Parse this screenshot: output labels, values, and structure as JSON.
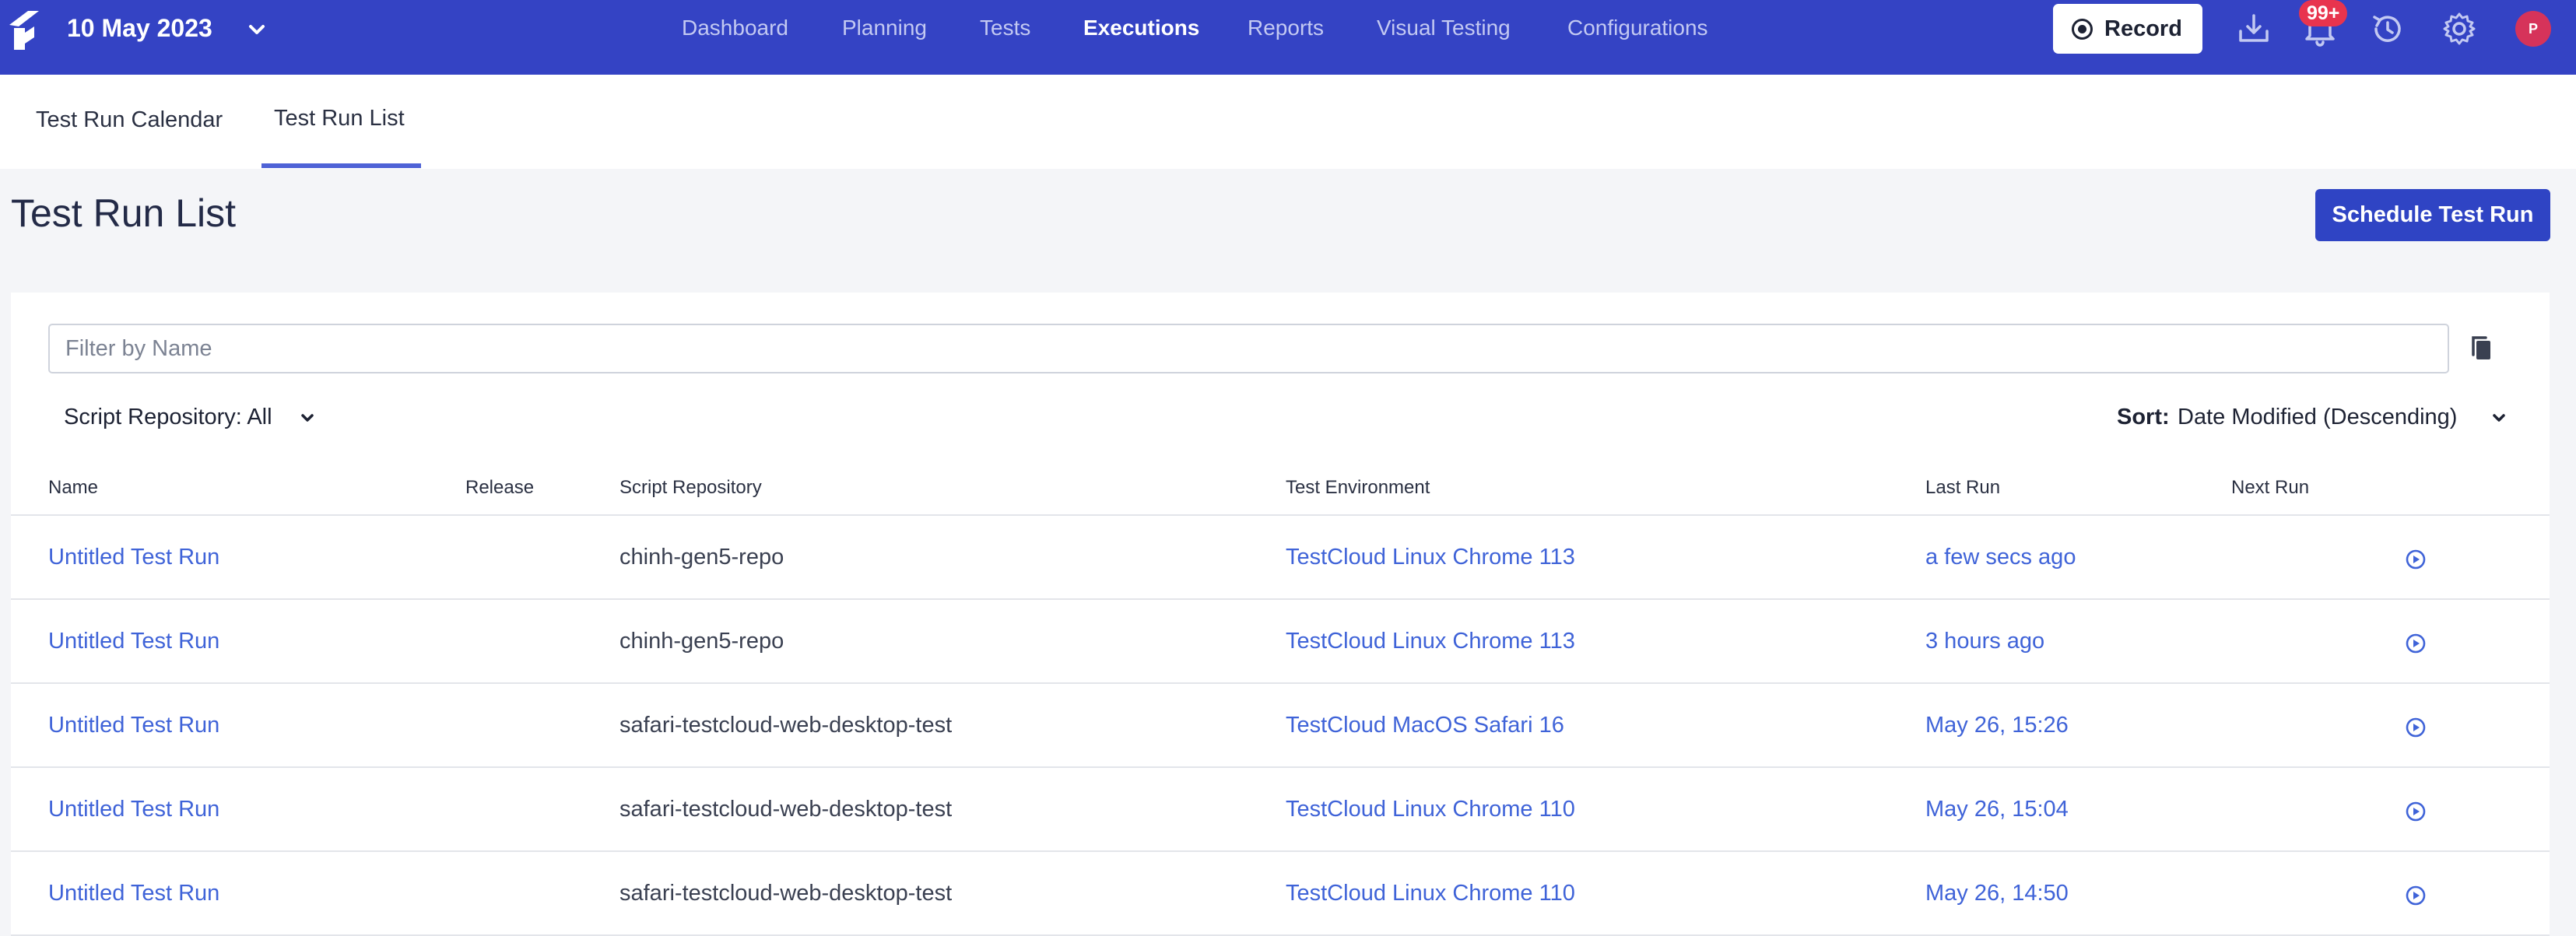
{
  "header": {
    "date": "10 May 2023",
    "nav": [
      "Dashboard",
      "Planning",
      "Tests",
      "Executions",
      "Reports",
      "Visual Testing",
      "Configurations"
    ],
    "active_nav": "Executions",
    "record_label": "Record",
    "notification_count": "99+",
    "avatar_initial": "P",
    "icons": [
      "logo-icon",
      "chevron-down-icon",
      "record-icon",
      "download-icon",
      "bell-icon",
      "history-icon",
      "gear-icon"
    ]
  },
  "tabs": {
    "calendar": "Test Run Calendar",
    "list": "Test Run List",
    "active": "Test Run List"
  },
  "page": {
    "title": "Test Run List",
    "schedule_button": "Schedule Test Run"
  },
  "filters": {
    "name_placeholder": "Filter by Name",
    "name_value": "",
    "repository": "Script Repository: All",
    "sort_label": "Sort:",
    "sort_value": "Date Modified (Descending)"
  },
  "table": {
    "columns": {
      "name": "Name",
      "release": "Release",
      "repository": "Script Repository",
      "environment": "Test Environment",
      "last_run": "Last Run",
      "next_run": "Next Run"
    },
    "rows": [
      {
        "name": "Untitled Test Run",
        "release": "",
        "repository": "chinh-gen5-repo",
        "environment": "TestCloud Linux Chrome 113",
        "last_run": "a few secs ago",
        "next_run": ""
      },
      {
        "name": "Untitled Test Run",
        "release": "",
        "repository": "chinh-gen5-repo",
        "environment": "TestCloud Linux Chrome 113",
        "last_run": "3 hours ago",
        "next_run": ""
      },
      {
        "name": "Untitled Test Run",
        "release": "",
        "repository": "safari-testcloud-web-desktop-test",
        "environment": "TestCloud MacOS Safari 16",
        "last_run": "May 26, 15:26",
        "next_run": ""
      },
      {
        "name": "Untitled Test Run",
        "release": "",
        "repository": "safari-testcloud-web-desktop-test",
        "environment": "TestCloud Linux Chrome 110",
        "last_run": "May 26, 15:04",
        "next_run": ""
      },
      {
        "name": "Untitled Test Run",
        "release": "",
        "repository": "safari-testcloud-web-desktop-test",
        "environment": "TestCloud Linux Chrome 110",
        "last_run": "May 26, 14:50",
        "next_run": ""
      }
    ]
  },
  "colors": {
    "header_bg": "#3443c4",
    "primary_button": "#2f44c4",
    "link": "#3f63d8",
    "active_tab_underline": "#4e62d6",
    "badge": "#e8344e",
    "avatar": "#d6335a"
  }
}
